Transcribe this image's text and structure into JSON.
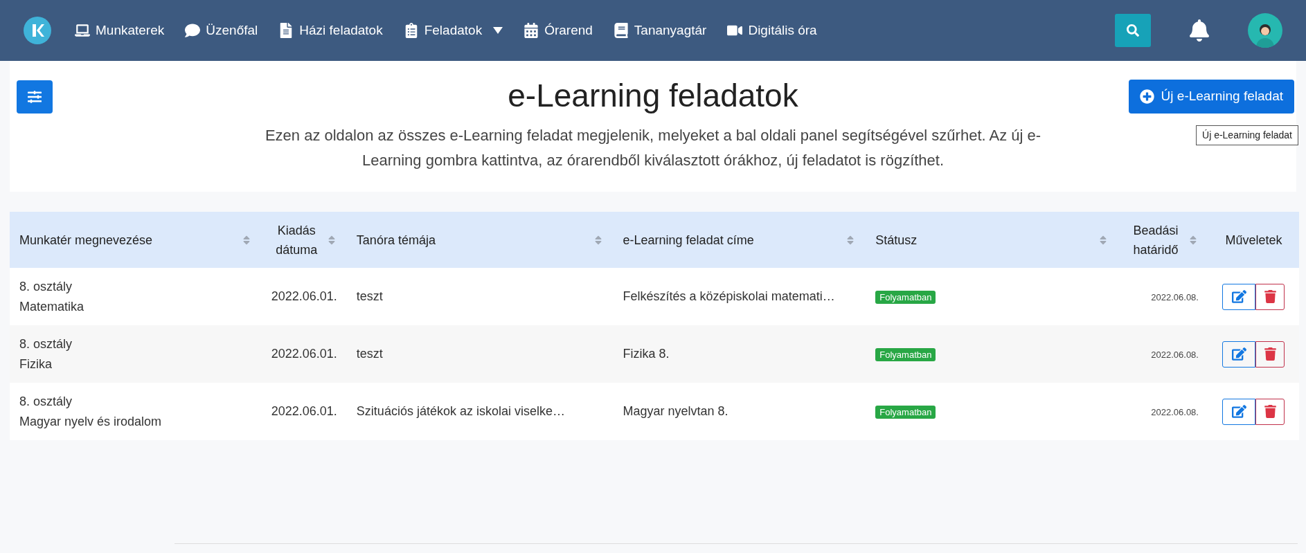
{
  "nav": {
    "items": [
      {
        "label": "Munkaterek",
        "dropdown": false
      },
      {
        "label": "Üzenőfal",
        "dropdown": false
      },
      {
        "label": "Házi feladatok",
        "dropdown": false
      },
      {
        "label": "Feladatok",
        "dropdown": true
      },
      {
        "label": "Órarend",
        "dropdown": false
      },
      {
        "label": "Tananyagtár",
        "dropdown": false
      },
      {
        "label": "Digitális óra",
        "dropdown": false
      }
    ]
  },
  "header": {
    "title": "e-Learning feladatok",
    "description": "Ezen az oldalon az összes e-Learning feladat megjelenik, melyeket a bal oldali panel segítségével szűrhet. Az új e-Learning gombra kattintva, az órarendből kiválasztott órákhoz, új feladatot is rögzíthet.",
    "new_button": "Új e-Learning feladat",
    "tooltip": "Új e-Learning feladat"
  },
  "table": {
    "columns": [
      {
        "label": "Munkatér megnevezése",
        "sortable": true
      },
      {
        "label": "Kiadás dátuma",
        "sortable": true
      },
      {
        "label": "Tanóra témája",
        "sortable": true
      },
      {
        "label": "e-Learning feladat címe",
        "sortable": true
      },
      {
        "label": "Státusz",
        "sortable": true
      },
      {
        "label": "Beadási határidő",
        "sortable": true
      },
      {
        "label": "Műveletek",
        "sortable": false
      }
    ],
    "rows": [
      {
        "class": "8. osztály",
        "subject": "Matematika",
        "date": "2022.06.01.",
        "topic": "teszt",
        "title": "Felkészítés a középiskolai matemati…",
        "status": "Folyamatban",
        "deadline": "2022.06.08."
      },
      {
        "class": "8. osztály",
        "subject": "Fizika",
        "date": "2022.06.01.",
        "topic": "teszt",
        "title": "Fizika 8.",
        "status": "Folyamatban",
        "deadline": "2022.06.08."
      },
      {
        "class": "8. osztály",
        "subject": "Magyar nyelv és irodalom",
        "date": "2022.06.01.",
        "topic": "Szituációs játékok az iskolai viselke…",
        "title": "Magyar nyelvtan 8.",
        "status": "Folyamatban",
        "deadline": "2022.06.08."
      }
    ]
  }
}
